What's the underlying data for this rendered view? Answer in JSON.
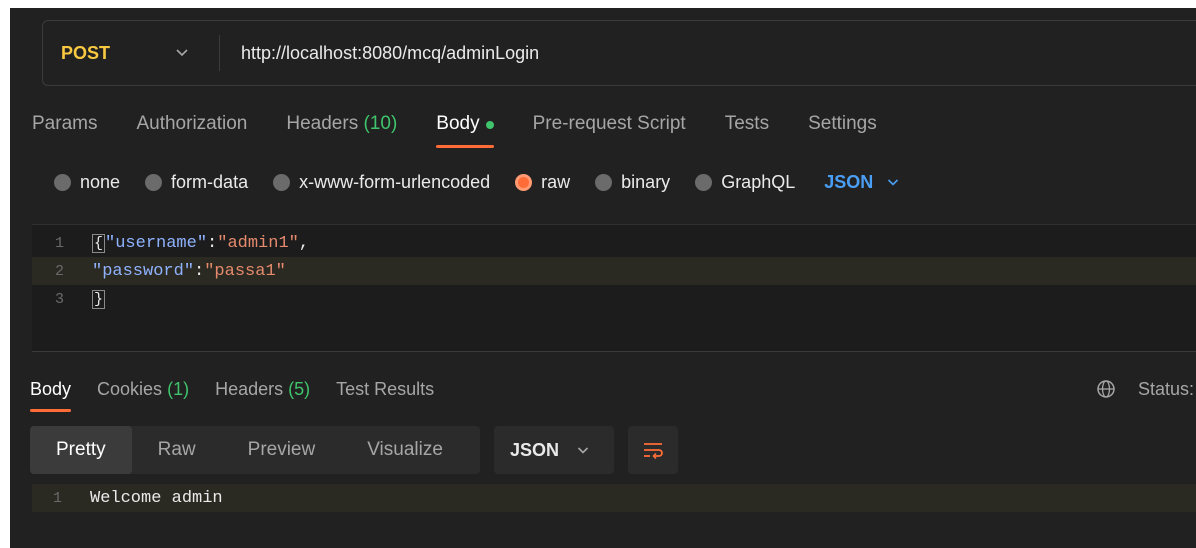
{
  "request": {
    "method": "POST",
    "url": "http://localhost:8080/mcq/adminLogin"
  },
  "request_tabs": {
    "params": "Params",
    "authorization": "Authorization",
    "headers": "Headers",
    "headers_count": "(10)",
    "body": "Body",
    "pre_request": "Pre-request Script",
    "tests": "Tests",
    "settings": "Settings",
    "active": "Body"
  },
  "body_types": {
    "none": "none",
    "form_data": "form-data",
    "urlencoded": "x-www-form-urlencoded",
    "raw": "raw",
    "binary": "binary",
    "graphql": "GraphQL",
    "selected": "raw",
    "format": "JSON"
  },
  "editor": {
    "lines": [
      {
        "num": "1",
        "open": "{",
        "key": "\"username\"",
        "colon": ":",
        "value": "\"admin1\"",
        "tail": ","
      },
      {
        "num": "2",
        "key": "\"password\"",
        "colon": ":",
        "value": "\"passa1\""
      },
      {
        "num": "3",
        "close": "}"
      }
    ]
  },
  "response_tabs": {
    "body": "Body",
    "cookies": "Cookies",
    "cookies_count": "(1)",
    "headers": "Headers",
    "headers_count": "(5)",
    "test_results": "Test Results",
    "status_label": "Status:"
  },
  "response_view": {
    "pretty": "Pretty",
    "raw": "Raw",
    "preview": "Preview",
    "visualize": "Visualize",
    "format": "JSON"
  },
  "response_body": {
    "lines": [
      {
        "num": "1",
        "text": "Welcome admin"
      }
    ]
  },
  "colors": {
    "background": "#212121",
    "method": "#f8c940",
    "accent": "#ff6c37",
    "count_green": "#3fc36b",
    "json_blue": "#4a9ff5"
  }
}
